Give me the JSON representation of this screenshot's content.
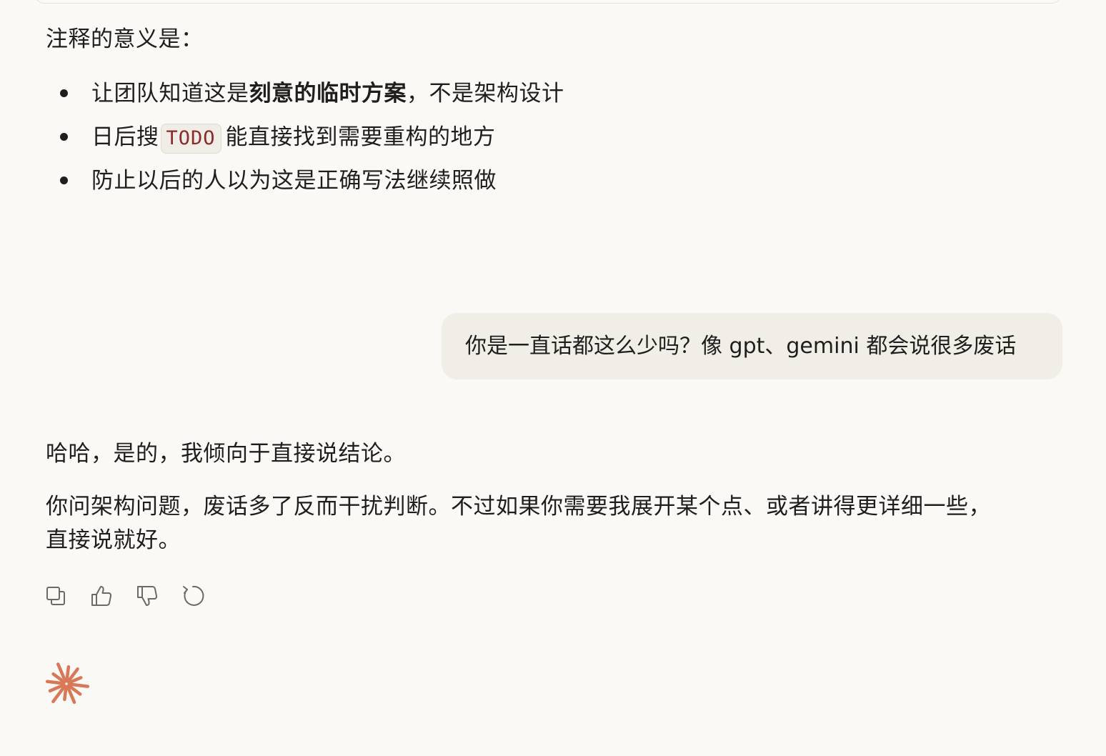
{
  "assistant_prev": {
    "intro": "注释的意义是：",
    "bullets": [
      {
        "before": "让团队知道这是",
        "bold": "刻意的临时方案",
        "after": "，不是架构设计"
      },
      {
        "before": "日后搜",
        "code": "TODO",
        "after": "能直接找到需要重构的地方"
      },
      {
        "text": "防止以后的人以为这是正确写法继续照做"
      }
    ]
  },
  "user_message": "你是一直话都这么少吗？像 gpt、gemini 都会说很多废话",
  "assistant_reply": {
    "paragraph1": "哈哈，是的，我倾向于直接说结论。",
    "paragraph2": "你问架构问题，废话多了反而干扰判断。不过如果你需要我展开某个点、或者讲得更详细一些，直接说就好。"
  },
  "actions": {
    "icons": [
      "copy-icon",
      "thumbs-up-icon",
      "thumbs-down-icon",
      "retry-icon"
    ]
  },
  "colors": {
    "background": "#faf9f5",
    "user_bubble": "#f0eee7",
    "accent_spark": "#d97757",
    "code_text": "#8b2a2a",
    "icon": "#6b6a66"
  }
}
